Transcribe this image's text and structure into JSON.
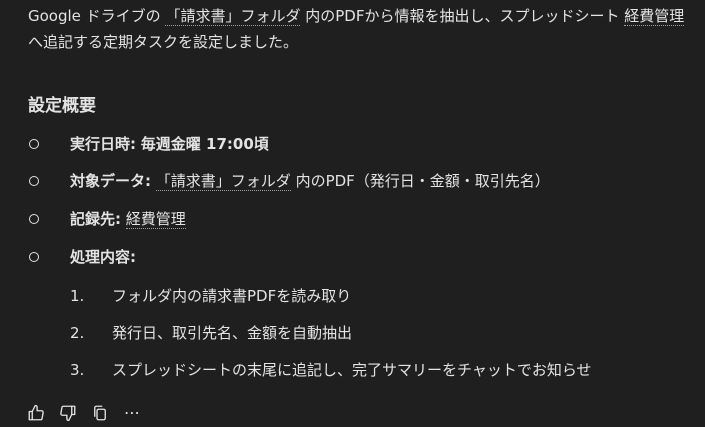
{
  "intro": {
    "part1": "Google ドライブの ",
    "folder_link": "「請求書」フォルダ",
    "part2": " 内のPDFから情報を抽出し、スプレッドシート ",
    "sheet_link": "経費管理",
    "part3": " へ追記する定期タスクを設定しました。"
  },
  "heading": "設定概要",
  "items": [
    {
      "label": "実行日時",
      "value": "毎週金曜 17:00頃"
    },
    {
      "label": "対象データ",
      "link": "「請求書」フォルダ",
      "value": " 内のPDF（発行日・金額・取引先名）"
    },
    {
      "label": "記録先",
      "link": "経費管理"
    },
    {
      "label": "処理内容",
      "steps": [
        {
          "num": "1.",
          "text": "フォルダ内の請求書PDFを読み取り"
        },
        {
          "num": "2.",
          "text": "発行日、取引先名、金額を自動抽出"
        },
        {
          "num": "3.",
          "text": "スプレッドシートの末尾に追記し、完了サマリーをチャットでお知らせ"
        }
      ]
    }
  ],
  "label_colon": ":",
  "actions": {
    "thumbs_up": "thumbs-up-icon",
    "thumbs_down": "thumbs-down-icon",
    "copy": "copy-icon",
    "more": "more-options-icon",
    "more_glyph": "⋯"
  }
}
